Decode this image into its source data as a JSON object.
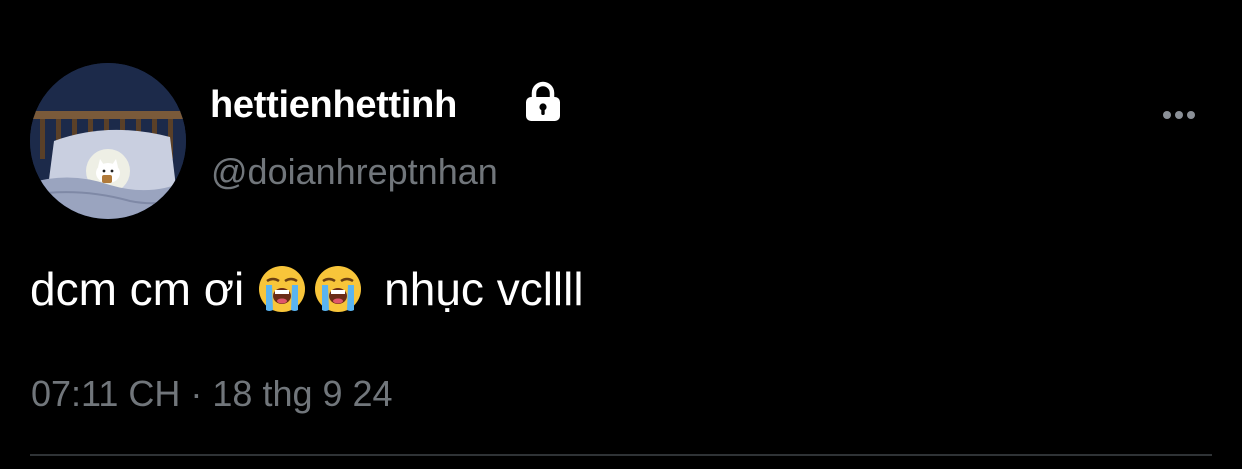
{
  "user": {
    "display_name": "hettienhettinh",
    "handle": "@doianhreptnhan",
    "protected": true,
    "avatar": "avatar-cat-in-bed"
  },
  "tweet": {
    "text_before": "dcm cm ơi",
    "emojis": [
      "loudly-crying-face",
      "loudly-crying-face"
    ],
    "text_after": "nhục vcllll",
    "timestamp": "07:11 CH · 18 thg 9 24"
  },
  "icons": {
    "lock": "lock-icon",
    "more": "more-options-icon"
  },
  "colors": {
    "background": "#000000",
    "primary_text": "#ffffff",
    "secondary_text": "#71767b",
    "divider": "#2f3336"
  }
}
